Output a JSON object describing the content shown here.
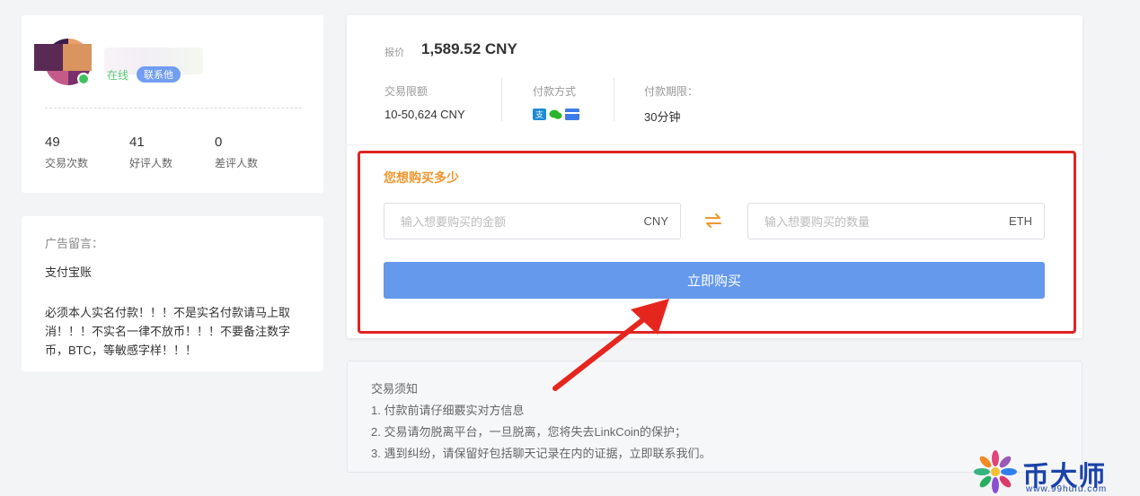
{
  "seller": {
    "status": "在线",
    "contact": "联系他",
    "stats": [
      {
        "value": "49",
        "label": "交易次数"
      },
      {
        "value": "41",
        "label": "好评人数"
      },
      {
        "value": "0",
        "label": "差评人数"
      }
    ]
  },
  "ad": {
    "title": "广告留言：",
    "line1": "支付宝账",
    "body": "必须本人实名付款！！！不是实名付款请马上取消！！！不实名一律不放币！！！不要备注数字币，BTC，等敏感字样！！！"
  },
  "offer": {
    "price_label": "报价",
    "price": "1,589.52 CNY",
    "limit_label": "交易限额",
    "limit": "10-50,624 CNY",
    "payment_label": "付款方式",
    "payment_icons": [
      "alipay-icon",
      "wechat-icon",
      "bank-card-icon"
    ],
    "term_label": "付款期限：",
    "term": "30分钟"
  },
  "buy": {
    "title": "您想购买多少",
    "amount_placeholder": "输入想要购买的金额",
    "amount_unit": "CNY",
    "qty_placeholder": "输入想要购买的数量",
    "qty_unit": "ETH",
    "button": "立即购买",
    "swap_icon": "swap-arrows-icon",
    "highlight_color": "#e02323",
    "accent_color": "#f0962f",
    "button_color": "#6499ec"
  },
  "notes": {
    "title": "交易须知",
    "items": [
      "1. 付款前请仔细覈实对方信息",
      "2. 交易请勿脱离平台，一旦脱离，您将失去LinkCoin的保护；",
      "3. 遇到纠纷，请保留好包括聊天记录在内的证据，立即联系我们。"
    ]
  },
  "watermark": {
    "text": "币大师",
    "url": "www.99hufu.com"
  }
}
